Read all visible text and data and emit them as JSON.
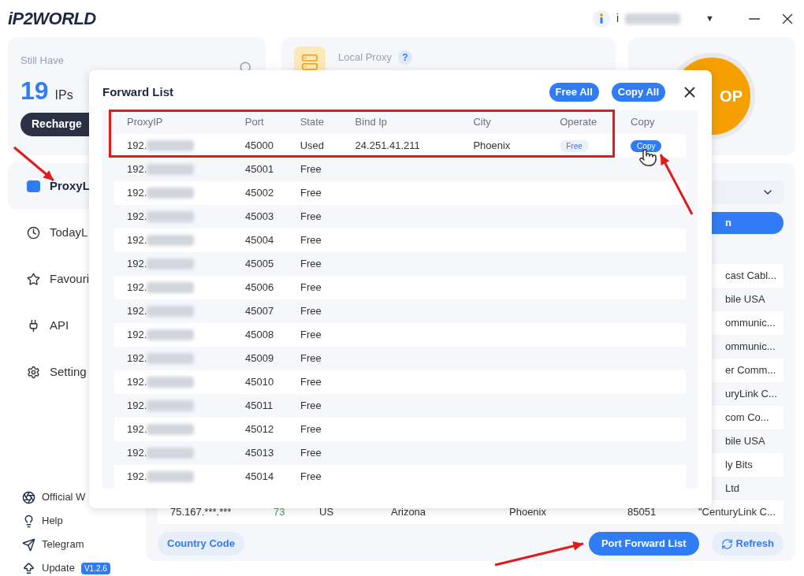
{
  "header": {
    "logo": "iP2WORLD",
    "user": {
      "name": "i",
      "caret": "▼"
    }
  },
  "summary": {
    "label": "Still Have",
    "count": "19",
    "unit": "IPs",
    "button": "Recharge"
  },
  "local_proxy": {
    "label": "Local Proxy",
    "help": "?"
  },
  "start_button": {
    "label": "OP"
  },
  "sidebar": {
    "items": [
      {
        "label": "ProxyL",
        "selected": true
      },
      {
        "label": "TodayL",
        "selected": false
      },
      {
        "label": "Favouri",
        "selected": false
      },
      {
        "label": "API",
        "selected": false
      },
      {
        "label": "Setting",
        "selected": false
      }
    ],
    "links": [
      {
        "label": "Official W"
      },
      {
        "label": "Help"
      },
      {
        "label": "Telegram"
      },
      {
        "label": "Update",
        "badge": "V1.2.6"
      }
    ]
  },
  "main": {
    "search_button": "n",
    "row_fragments": [
      "cast Cabl...",
      "bile USA",
      "ommunic...",
      "ommunic...",
      "er Comm...",
      "uryLink C...",
      "com Co...",
      "bile USA",
      "ly Bits",
      "Ltd"
    ],
    "last_row": [
      "75.167.***.***",
      "73",
      "US",
      "Arizona",
      "Phoenix",
      "85051",
      "\"CenturyLink C..."
    ],
    "buttons": {
      "country": "Country Code",
      "forward": "Port Forward List",
      "refresh": "Refresh"
    }
  },
  "modal": {
    "title": "Forward List",
    "buttons": [
      "Free All",
      "Copy All"
    ],
    "columns": [
      "ProxyIP",
      "Port",
      "State",
      "Bind Ip",
      "City",
      "Operate",
      "Copy"
    ],
    "rows": [
      {
        "proxy_ip": "192.",
        "port": "45000",
        "state": "Used",
        "bind_ip": "24.251.41.211",
        "city": "Phoenix",
        "operate": "Free",
        "copy": "Copy"
      },
      {
        "proxy_ip": "192.",
        "port": "45001",
        "state": "Free"
      },
      {
        "proxy_ip": "192.",
        "port": "45002",
        "state": "Free"
      },
      {
        "proxy_ip": "192.",
        "port": "45003",
        "state": "Free"
      },
      {
        "proxy_ip": "192.",
        "port": "45004",
        "state": "Free"
      },
      {
        "proxy_ip": "192.",
        "port": "45005",
        "state": "Free"
      },
      {
        "proxy_ip": "192.",
        "port": "45006",
        "state": "Free"
      },
      {
        "proxy_ip": "192.",
        "port": "45007",
        "state": "Free"
      },
      {
        "proxy_ip": "192.",
        "port": "45008",
        "state": "Free"
      },
      {
        "proxy_ip": "192.",
        "port": "45009",
        "state": "Free"
      },
      {
        "proxy_ip": "192.",
        "port": "45010",
        "state": "Free"
      },
      {
        "proxy_ip": "192.",
        "port": "45011",
        "state": "Free"
      },
      {
        "proxy_ip": "192.",
        "port": "45012",
        "state": "Free"
      },
      {
        "proxy_ip": "192.",
        "port": "45013",
        "state": "Free"
      },
      {
        "proxy_ip": "192.",
        "port": "45014",
        "state": "Free"
      }
    ]
  }
}
